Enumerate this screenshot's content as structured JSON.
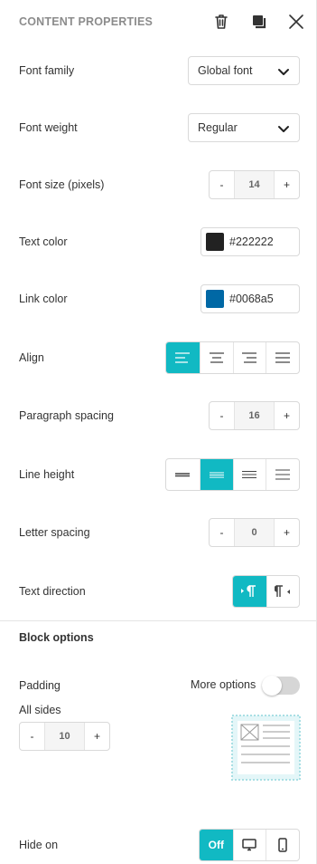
{
  "header": {
    "title": "CONTENT PROPERTIES",
    "icons": [
      "trash-icon",
      "duplicate-icon",
      "close-icon"
    ]
  },
  "rows": {
    "font_family": {
      "label": "Font family",
      "value": "Global font"
    },
    "font_weight": {
      "label": "Font weight",
      "value": "Regular"
    },
    "font_size": {
      "label": "Font size (pixels)",
      "value": "14",
      "minus": "-",
      "plus": "+"
    },
    "text_color": {
      "label": "Text color",
      "value": "#222222",
      "swatch": "#222222"
    },
    "link_color": {
      "label": "Link color",
      "value": "#0068a5",
      "swatch": "#0068a5"
    },
    "align": {
      "label": "Align",
      "options": [
        "align-left-icon",
        "align-center-icon",
        "align-right-icon",
        "align-justify-icon"
      ],
      "selected": "align-left-icon"
    },
    "paragraph_spacing": {
      "label": "Paragraph spacing",
      "value": "16",
      "minus": "-",
      "plus": "+"
    },
    "line_height": {
      "label": "Line height",
      "options": [
        "line-height-tight-icon",
        "line-height-normal-icon",
        "line-height-relaxed-icon",
        "line-height-loose-icon"
      ],
      "selected": "line-height-normal-icon"
    },
    "letter_spacing": {
      "label": "Letter spacing",
      "value": "0",
      "minus": "-",
      "plus": "+"
    },
    "text_direction": {
      "label": "Text direction",
      "options": [
        "ltr-icon",
        "rtl-icon"
      ],
      "selected": "ltr-icon"
    }
  },
  "block_options": {
    "title": "Block options",
    "padding": {
      "label": "Padding",
      "more_options_label": "More options",
      "more_options_on": false,
      "sub_label": "All sides",
      "value": "10",
      "minus": "-",
      "plus": "+"
    },
    "hide_on": {
      "label": "Hide on",
      "off_label": "Off",
      "options": [
        "Off",
        "desktop-icon",
        "mobile-icon"
      ],
      "selected": "Off"
    }
  },
  "colors": {
    "accent": "#11b9c3",
    "border": "#d9d9d9",
    "header_text": "#8c8c8c"
  }
}
